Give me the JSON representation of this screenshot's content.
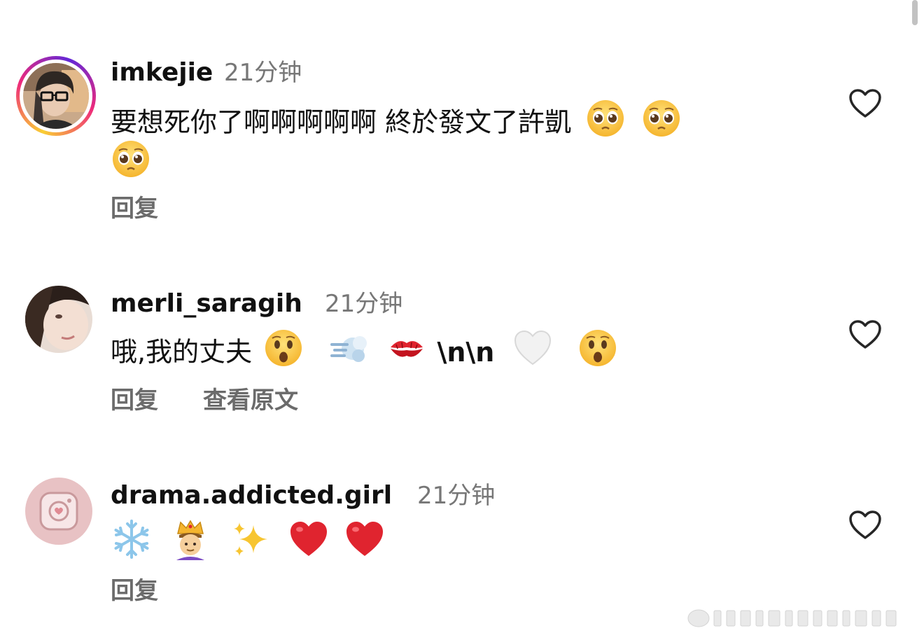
{
  "comments": [
    {
      "username": "imkejie",
      "timestamp": "21分钟",
      "text_line1": "要想死你了啊啊啊啊啊 終於發文了許凱",
      "reply_label": "回复",
      "emojis_line1": [
        "pleading-face-icon",
        "pleading-face-icon"
      ],
      "emojis_line2": [
        "pleading-face-icon"
      ],
      "has_story_ring": true
    },
    {
      "username": "merli_saragih",
      "timestamp": "21分钟",
      "text_prefix": "哦,我的丈夫",
      "text_mid": "\\n\\n",
      "reply_label": "回复",
      "translate_label": "查看原文",
      "emojis": [
        "surprised-face-icon",
        "dash-icon",
        "kiss-mark-icon",
        "white-heart-icon",
        "surprised-face-icon"
      ],
      "has_story_ring": false
    },
    {
      "username": "drama.addicted.girl",
      "timestamp": "21分钟",
      "reply_label": "回复",
      "emojis": [
        "snowflake-icon",
        "prince-icon",
        "sparkles-icon",
        "red-heart-icon",
        "red-heart-icon"
      ],
      "has_story_ring": false
    }
  ],
  "colors": {
    "text_primary": "#111111",
    "text_secondary": "#777777",
    "action_text": "#6b6b6b",
    "heart_outline": "#262626",
    "red_heart": "#e0242f"
  }
}
